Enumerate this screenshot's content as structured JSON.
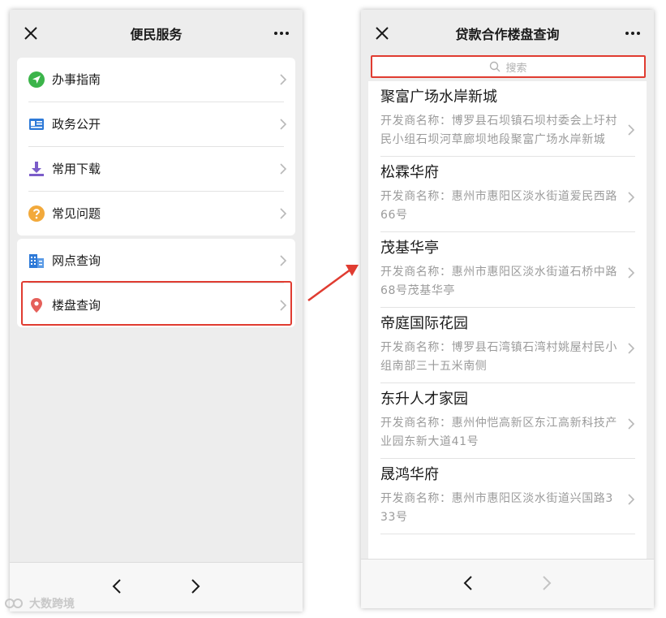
{
  "left_screen": {
    "title": "便民服务",
    "group1": [
      {
        "label": "办事指南",
        "icon": "navigation-arrow-icon"
      },
      {
        "label": "政务公开",
        "icon": "id-card-icon"
      },
      {
        "label": "常用下载",
        "icon": "download-icon"
      },
      {
        "label": "常见问题",
        "icon": "question-circle-icon"
      }
    ],
    "group2": [
      {
        "label": "网点查询",
        "icon": "building-icon"
      },
      {
        "label": "楼盘查询",
        "icon": "location-pin-icon"
      }
    ]
  },
  "right_screen": {
    "title": "贷款合作楼盘查询",
    "search_placeholder": "搜索",
    "estates": [
      {
        "name": "聚富广场水岸新城",
        "developer": "开发商名称：博罗县石坝镇石坝村委会上圩村民小组石坝河草廊坝地段聚富广场水岸新城"
      },
      {
        "name": "松霖华府",
        "developer": "开发商名称：惠州市惠阳区淡水街道爱民西路66号"
      },
      {
        "name": "茂基华亭",
        "developer": "开发商名称：惠州市惠阳区淡水街道石桥中路68号茂基华亭"
      },
      {
        "name": "帝庭国际花园",
        "developer": "开发商名称：博罗县石湾镇石湾村姚屋村民小组南部三十五米南侧"
      },
      {
        "name": "东升人才家园",
        "developer": "开发商名称：惠州仲恺高新区东江高新科技产业园东新大道41号"
      },
      {
        "name": "晟鸿华府",
        "developer": "开发商名称：惠州市惠阳区淡水街道兴国路333号"
      }
    ]
  },
  "watermark": "大数跨境",
  "colors": {
    "highlight": "#e03c31",
    "page_bg": "#ededed",
    "card_bg": "#ffffff",
    "text_primary": "#1a1a1a",
    "text_secondary": "#9b9b9b"
  }
}
